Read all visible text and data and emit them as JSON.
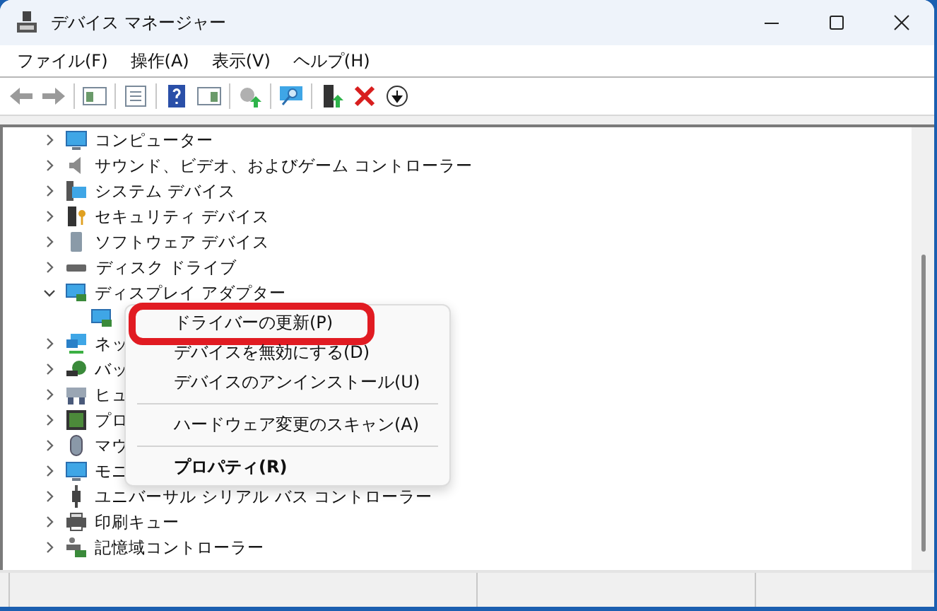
{
  "window": {
    "title": "デバイス マネージャー"
  },
  "menu_bar": [
    "ファイル(F)",
    "操作(A)",
    "表示(V)",
    "ヘルプ(H)"
  ],
  "tree": [
    {
      "label": "コンピューター",
      "expanded": false
    },
    {
      "label": "サウンド、ビデオ、およびゲーム コントローラー",
      "expanded": false
    },
    {
      "label": "システム デバイス",
      "expanded": false
    },
    {
      "label": "セキュリティ デバイス",
      "expanded": false
    },
    {
      "label": "ソフトウェア デバイス",
      "expanded": false
    },
    {
      "label": "ディスク ドライブ",
      "expanded": false
    },
    {
      "label": "ディスプレイ アダプター",
      "expanded": true,
      "children": [
        {
          "kind": "device"
        }
      ]
    },
    {
      "label": "ネッ",
      "expanded": false
    },
    {
      "label": "バッ",
      "expanded": false
    },
    {
      "label": "ヒュ",
      "expanded": false
    },
    {
      "label": "プロ",
      "expanded": false
    },
    {
      "label": "マウ",
      "expanded": false
    },
    {
      "label": "モニ",
      "expanded": false
    },
    {
      "label": "ユニバーサル シリアル バス コントローラー",
      "expanded": false
    },
    {
      "label": "印刷キュー",
      "expanded": false
    },
    {
      "label": "記憶域コントローラー",
      "expanded": false
    }
  ],
  "context_menu": {
    "items": [
      {
        "kind": "item",
        "label": "ドライバーの更新(P)",
        "highlighted": true,
        "default": false
      },
      {
        "kind": "item",
        "label": "デバイスを無効にする(D)",
        "highlighted": false,
        "default": false
      },
      {
        "kind": "item",
        "label": "デバイスのアンインストール(U)",
        "highlighted": false,
        "default": false
      },
      {
        "kind": "separator"
      },
      {
        "kind": "item",
        "label": "ハードウェア変更のスキャン(A)",
        "highlighted": false,
        "default": false
      },
      {
        "kind": "separator"
      },
      {
        "kind": "item",
        "label": "プロパティ(R)",
        "highlighted": false,
        "default": true
      }
    ]
  }
}
